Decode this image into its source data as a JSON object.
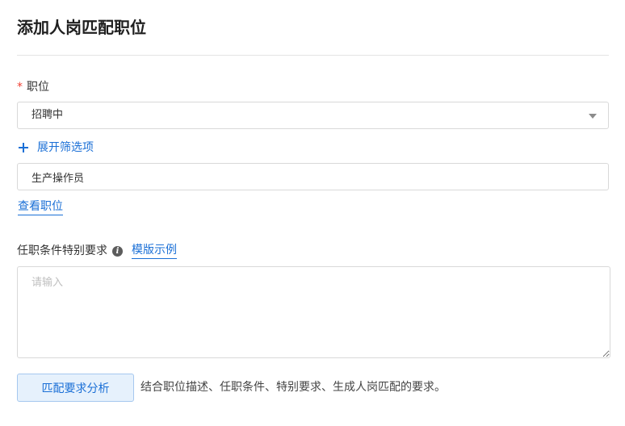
{
  "page": {
    "title": "添加人岗匹配职位"
  },
  "job_field": {
    "required_mark": "*",
    "label": "职位",
    "status_select_value": "招聘中",
    "expand_filters_label": "展开筛选项",
    "job_input_value": "生产操作员",
    "view_job_link": "查看职位"
  },
  "requirements": {
    "label": "任职条件特别要求",
    "info_icon": "info-icon",
    "template_link": "模版示例",
    "textarea_placeholder": "请输入",
    "textarea_value": ""
  },
  "analysis": {
    "button_label": "匹配要求分析",
    "hint": "结合职位描述、任职条件、特别要求、生成人岗匹配的要求。"
  },
  "colors": {
    "accent": "#1a6fd6",
    "required": "#f04134",
    "button_bg": "#e6f1fc",
    "border": "#d9d9d9"
  }
}
